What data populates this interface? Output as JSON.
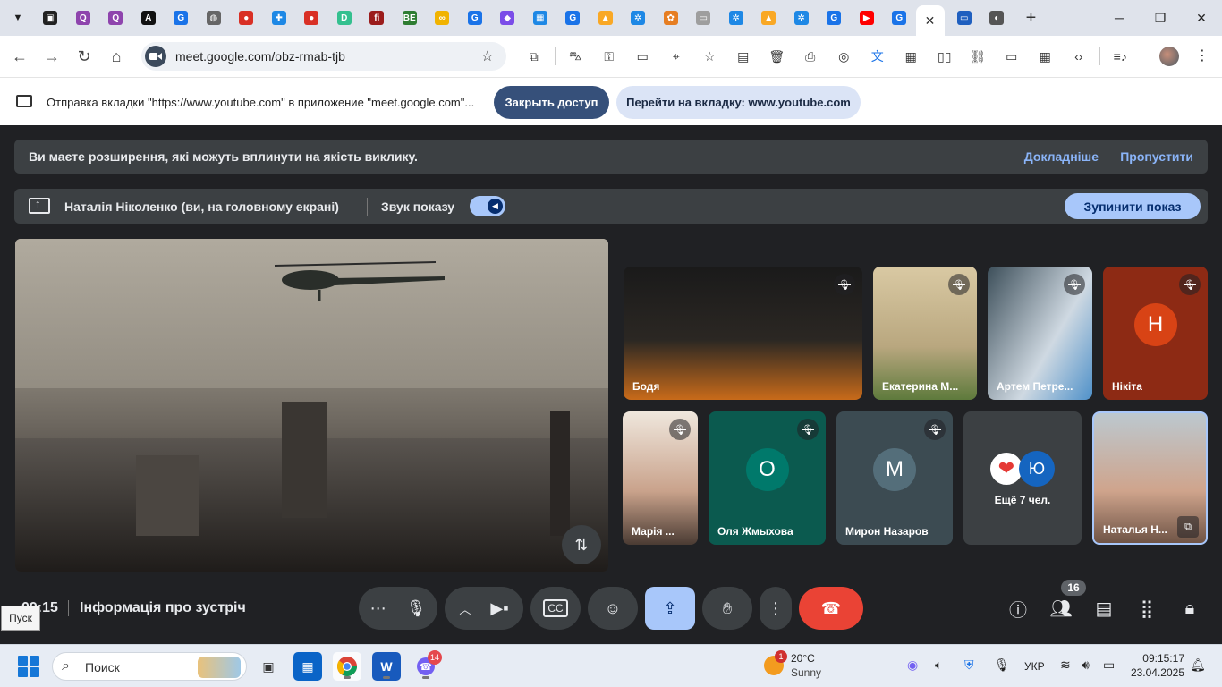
{
  "browser": {
    "tabs": [
      {
        "icon": "tab-icon-1",
        "color": "#222222",
        "glyph": "▣"
      },
      {
        "icon": "tab-icon-2",
        "color": "#8e44ad",
        "glyph": "Q"
      },
      {
        "icon": "tab-icon-3",
        "color": "#8e44ad",
        "glyph": "Q"
      },
      {
        "icon": "tab-icon-4",
        "color": "#111111",
        "glyph": "A"
      },
      {
        "icon": "tab-icon-5",
        "color": "#1a73e8",
        "glyph": "G"
      },
      {
        "icon": "tab-icon-6",
        "color": "#666666",
        "glyph": "◍"
      },
      {
        "icon": "tab-icon-7",
        "color": "#d93025",
        "glyph": "●"
      },
      {
        "icon": "tab-icon-8",
        "color": "#1e88e5",
        "glyph": "✚"
      },
      {
        "icon": "tab-icon-9",
        "color": "#d93025",
        "glyph": "●"
      },
      {
        "icon": "tab-icon-10",
        "color": "#34c08f",
        "glyph": "D"
      },
      {
        "icon": "tab-icon-11",
        "color": "#9b1c1c",
        "glyph": "fi"
      },
      {
        "icon": "tab-icon-12",
        "color": "#2e7d32",
        "glyph": "ВЕ"
      },
      {
        "icon": "tab-icon-13",
        "color": "#f1b300",
        "glyph": "∞"
      },
      {
        "icon": "tab-icon-14",
        "color": "#1a73e8",
        "glyph": "G"
      },
      {
        "icon": "tab-icon-15",
        "color": "#7b4de8",
        "glyph": "◆"
      },
      {
        "icon": "tab-icon-16",
        "color": "#1e88e5",
        "glyph": "▦"
      },
      {
        "icon": "tab-icon-17",
        "color": "#1a73e8",
        "glyph": "G"
      },
      {
        "icon": "tab-icon-18",
        "color": "#f9a825",
        "glyph": "▲"
      },
      {
        "icon": "tab-icon-19",
        "color": "#1e88e5",
        "glyph": "✲"
      },
      {
        "icon": "tab-icon-20",
        "color": "#e67e22",
        "glyph": "✿"
      },
      {
        "icon": "tab-icon-21",
        "color": "#9e9e9e",
        "glyph": "▭"
      },
      {
        "icon": "tab-icon-22",
        "color": "#1e88e5",
        "glyph": "✲"
      },
      {
        "icon": "tab-icon-23",
        "color": "#f9a825",
        "glyph": "▲"
      },
      {
        "icon": "tab-icon-24",
        "color": "#1e88e5",
        "glyph": "✲"
      },
      {
        "icon": "tab-icon-25",
        "color": "#1a73e8",
        "glyph": "G"
      },
      {
        "icon": "tab-icon-26",
        "color": "#ff0000",
        "glyph": "▶"
      },
      {
        "icon": "tab-icon-27",
        "color": "#1a73e8",
        "glyph": "G"
      }
    ],
    "active_tab_close": "✕",
    "trailing_tabs": [
      {
        "icon": "tab-icon-28",
        "color": "#1f5fbf",
        "glyph": "▭"
      },
      {
        "icon": "tab-icon-29",
        "color": "#555555",
        "glyph": "◐"
      }
    ],
    "url": "meet.google.com/obz-rmab-tjb"
  },
  "infobar": {
    "message": "Отправка вкладки \"https://www.youtube.com\" в приложение \"meet.google.com\"...",
    "close_access": "Закрыть доступ",
    "goto_tab": "Перейти на вкладку: www.youtube.com"
  },
  "meet": {
    "warning": "Ви маєте розширення, які можуть вплинути на якість виклику.",
    "learn_more": "Докладніше",
    "skip": "Пропустити",
    "presenter": "Наталія Ніколенко (ви, на головному екрані)",
    "share_sound": "Звук показу",
    "stop_share": "Зупинити показ",
    "participants": [
      {
        "name": "Бодя",
        "muted": true
      },
      {
        "name": "Екатерина М...",
        "muted": true
      },
      {
        "name": "Артем Петре...",
        "muted": true
      },
      {
        "name": "Нікіта",
        "muted": true,
        "initial": "Н",
        "color": "#d84315"
      },
      {
        "name": "Марія ...",
        "muted": true
      },
      {
        "name": "Оля Жмыхова",
        "muted": true,
        "initial": "О",
        "color": "#00796b"
      },
      {
        "name": "Мирон Назаров",
        "muted": true,
        "initial": "М",
        "color": "#546e7a"
      },
      {
        "name": "Наталья Н...",
        "muted": false
      }
    ],
    "others": {
      "label": "Ещё 7 чел.",
      "initial": "Ю",
      "color": "#1565c0"
    },
    "clock": "09:15",
    "meeting_info": "Інформація про зустріч",
    "participant_count": "16",
    "tooltip": "Пуск"
  },
  "taskbar": {
    "search_placeholder": "Поиск",
    "viber_badge": "14",
    "weather_badge": "1",
    "temperature": "20°C",
    "condition": "Sunny",
    "language": "УКР",
    "time": "09:15:17",
    "date": "23.04.2025"
  }
}
